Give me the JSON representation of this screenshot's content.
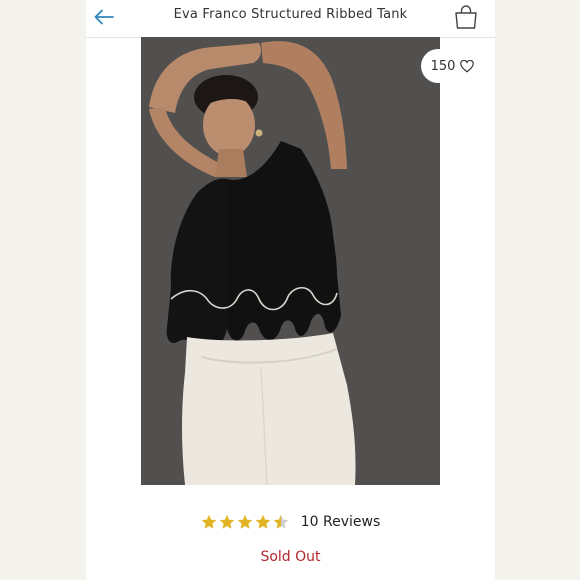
{
  "header": {
    "title": "Eva Franco Structured Ribbed Tank",
    "back_icon": "arrow-left-icon",
    "bag_icon": "shopping-bag-icon"
  },
  "product": {
    "likes": "150",
    "like_icon": "heart-icon",
    "rating": 4.5,
    "max_rating": 5,
    "reviews_label": "10 Reviews",
    "status": "Sold Out"
  },
  "colors": {
    "accent": "#2f88b9",
    "star": "#e3b526",
    "sold_out": "#b3272d"
  }
}
